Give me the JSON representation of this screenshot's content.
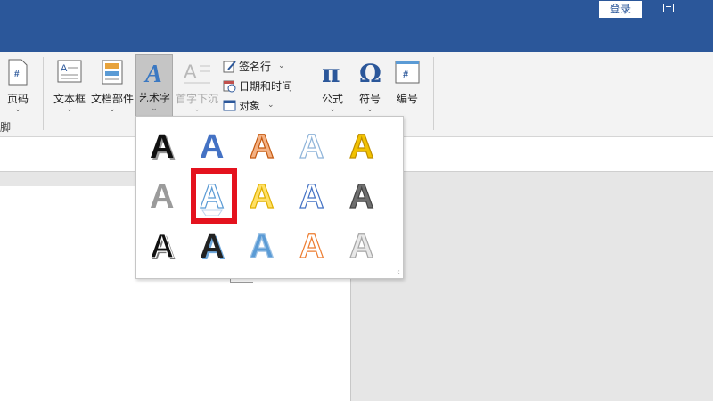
{
  "titlebar": {
    "login_label": "登录",
    "color": "#2b579a"
  },
  "ribbon": {
    "left_cut_label": "页码",
    "left_group_label": "脚",
    "text_box_label": "文本框",
    "quick_parts_label": "文档部件",
    "wordart_label": "艺术字",
    "drop_cap_label": "首字下沉",
    "signature_line_label": "签名行",
    "date_time_label": "日期和时间",
    "object_label": "对象",
    "equation_label": "公式",
    "symbol_label": "符号",
    "number_label": "编号"
  },
  "wordart_gallery": {
    "highlight_color": "#e4121e",
    "highlighted_index": 6,
    "items": [
      {
        "glyph": "A",
        "style": "fill-black-shadow"
      },
      {
        "glyph": "A",
        "style": "fill-blue"
      },
      {
        "glyph": "A",
        "style": "fill-orange-outline"
      },
      {
        "glyph": "A",
        "style": "outline-light-blue"
      },
      {
        "glyph": "A",
        "style": "fill-gold"
      },
      {
        "glyph": "A",
        "style": "fill-gray"
      },
      {
        "glyph": "A",
        "style": "outline-blue-reflection"
      },
      {
        "glyph": "A",
        "style": "fill-yellow"
      },
      {
        "glyph": "A",
        "style": "outline-blue"
      },
      {
        "glyph": "A",
        "style": "fill-gray-gradient"
      },
      {
        "glyph": "A",
        "style": "fill-black-outline"
      },
      {
        "glyph": "A",
        "style": "fill-black-blue-shadow"
      },
      {
        "glyph": "A",
        "style": "fill-blue-bevel"
      },
      {
        "glyph": "A",
        "style": "outline-orange"
      },
      {
        "glyph": "A",
        "style": "fill-silver"
      }
    ]
  }
}
